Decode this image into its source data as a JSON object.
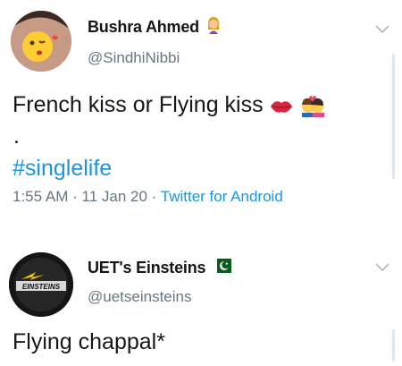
{
  "tweets": [
    {
      "display_name": "Bushra Ahmed",
      "handle": "@SindhiNibbi",
      "badge_icon": "woman-emoji",
      "text": "French kiss or Flying kiss",
      "emojis": [
        "kiss-mark-emoji",
        "kissing-couple-emoji"
      ],
      "extra_line": ".",
      "hashtag": "#singlelife",
      "time": "1:55 AM",
      "separator": "·",
      "date": "11 Jan 20",
      "source": "Twitter for Android"
    },
    {
      "display_name": "UET's Einsteins",
      "handle": "@uetseinsteins",
      "badge_icon": "pakistan-flag-emoji",
      "avatar_text": "EINSTEINS",
      "text": "Flying chappal*"
    }
  ],
  "colors": {
    "text": "#14171a",
    "secondary": "#657786",
    "link": "#1b95e0"
  }
}
